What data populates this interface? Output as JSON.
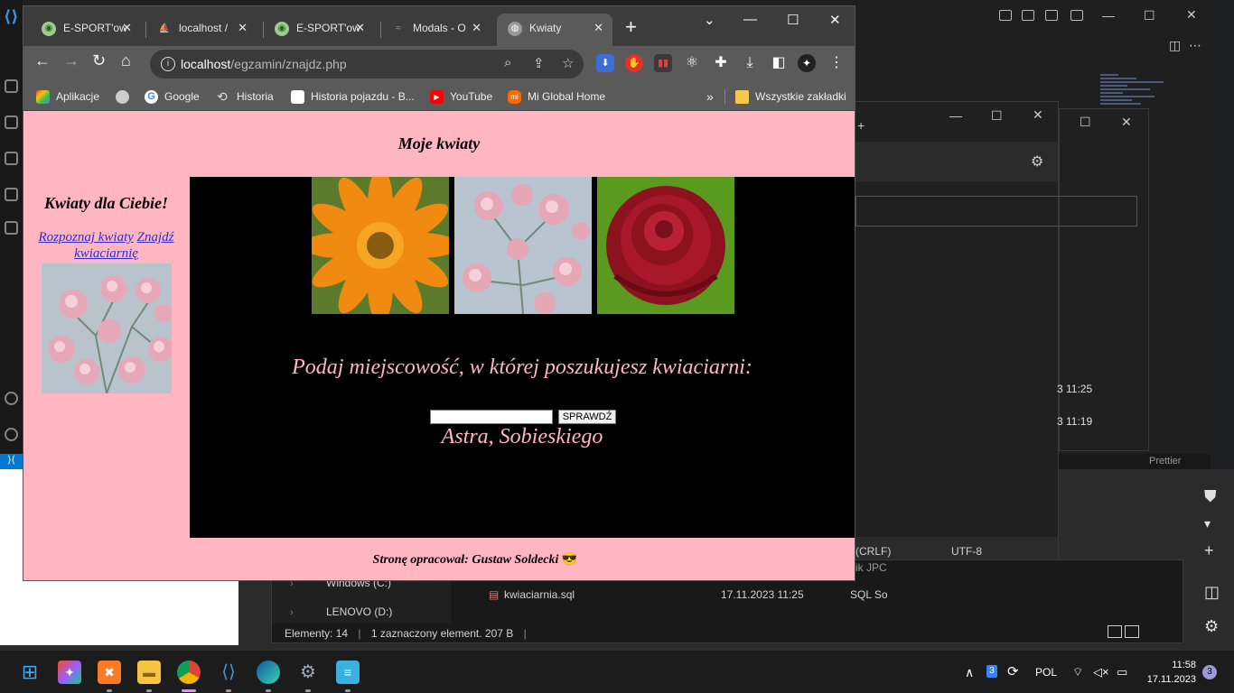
{
  "browser": {
    "tabs": [
      {
        "label": "E-SPORT'ow",
        "active": false
      },
      {
        "label": "localhost /",
        "active": false
      },
      {
        "label": "E-SPORT'ow",
        "active": false
      },
      {
        "label": "Modals - O",
        "active": false
      },
      {
        "label": "Kwiaty",
        "active": true
      }
    ],
    "new_tab": "+",
    "window_controls": {
      "dropdown": "⌄",
      "minimize": "—",
      "maximize": "☐",
      "close": "✕"
    },
    "address": {
      "host": "localhost",
      "path": "/egzamin/znajdz.php"
    },
    "bookmarks": [
      {
        "label": "Aplikacje",
        "icon": "apps-grid-icon",
        "color": "#e8453c"
      },
      {
        "label": "",
        "icon": "globe-icon",
        "color": "#cccccc"
      },
      {
        "label": "Google",
        "icon": "google-icon",
        "color": "#4285f4"
      },
      {
        "label": "Historia",
        "icon": "history-icon",
        "color": "#cccccc"
      },
      {
        "label": "Historia pojazdu - B...",
        "icon": "car-history-icon",
        "color": "#ffffff"
      },
      {
        "label": "YouTube",
        "icon": "youtube-icon",
        "color": "#ff0000"
      },
      {
        "label": "Mi Global Home",
        "icon": "mi-icon",
        "color": "#ff6900"
      }
    ],
    "bookmarks_more": "»",
    "all_bookmarks": "Wszystkie zakładki"
  },
  "page": {
    "header": "Moje kwiaty",
    "left_title": "Kwiaty dla Ciebie!",
    "links": [
      "Rozpoznaj kwiaty",
      "Znajdź kwiaciarnię"
    ],
    "prompt": "Podaj miejscowość, w której poszukujesz kwiaciarni:",
    "search_value": "",
    "button_label": "SPRAWDŹ",
    "result": "Astra, Sobieskiego",
    "footer": "Stronę opracował: Gustaw Soldecki",
    "footer_emoji": "😎",
    "colors": {
      "pink": "#ffb6c1",
      "black": "#000000",
      "link": "#2f2fcc"
    }
  },
  "background": {
    "vscode_status": "Prettier",
    "settings_footer": [
      "(CRLF)",
      "UTF-8"
    ],
    "times": [
      "3 11:25",
      "3 11:19"
    ],
    "explorer": {
      "nav_items": [
        "Windows (C:)",
        "LENOVO (D:)"
      ],
      "file_name": "kwiaciarnia.sql",
      "file_date": "17.11.2023 11:25",
      "file_type": "SQL So",
      "status_count": "Elementy: 14",
      "status_selected": "1 zaznaczony element. 207 B",
      "partial": "ik JPC"
    }
  },
  "taskbar": {
    "tray_lang": "POL",
    "time": "11:58",
    "date": "17.11.2023",
    "notifications": "3",
    "tray_badge": "3"
  }
}
